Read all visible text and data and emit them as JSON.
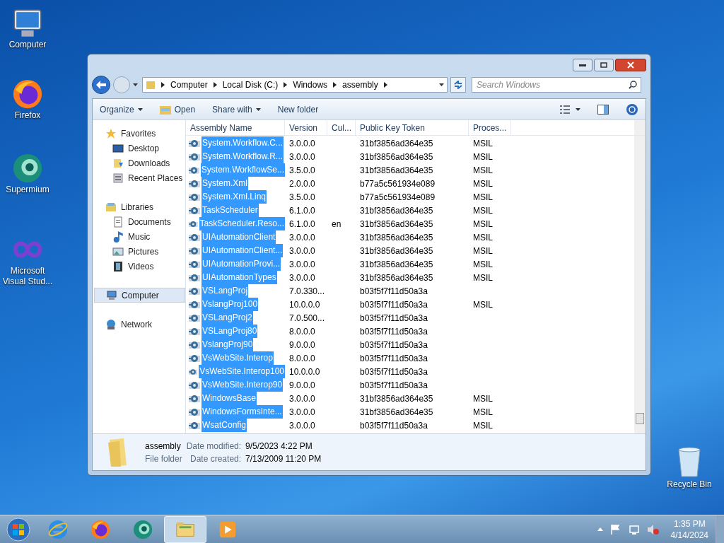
{
  "desktop_icons": [
    {
      "label": "Computer",
      "kind": "computer"
    },
    {
      "label": "Firefox",
      "kind": "firefox"
    },
    {
      "label": "Supermium",
      "kind": "supermium"
    },
    {
      "label": "Microsoft Visual Stud...",
      "kind": "vs"
    }
  ],
  "recycle_bin": {
    "label": "Recycle Bin"
  },
  "window": {
    "breadcrumbs": [
      "Computer",
      "Local Disk (C:)",
      "Windows",
      "assembly"
    ],
    "search": {
      "placeholder": "Search Windows"
    },
    "toolbar": [
      {
        "label": "Organize",
        "kind": "menu"
      },
      {
        "label": "Open",
        "kind": "open"
      },
      {
        "label": "Share with",
        "kind": "menu"
      },
      {
        "label": "New folder",
        "kind": "plain"
      }
    ],
    "sidebar": [
      {
        "label": "Favorites",
        "kind": "star",
        "selected": false,
        "children": [
          {
            "label": "Desktop",
            "kind": "desktop",
            "selected": false
          },
          {
            "label": "Downloads",
            "kind": "downloads",
            "selected": false
          },
          {
            "label": "Recent Places",
            "kind": "recent",
            "selected": false
          }
        ]
      },
      {
        "label": "Libraries",
        "kind": "library",
        "selected": false,
        "children": [
          {
            "label": "Documents",
            "kind": "documents",
            "selected": false
          },
          {
            "label": "Music",
            "kind": "music",
            "selected": false
          },
          {
            "label": "Pictures",
            "kind": "pictures",
            "selected": false
          },
          {
            "label": "Videos",
            "kind": "videos",
            "selected": false
          }
        ]
      },
      {
        "label": "Computer",
        "kind": "computer",
        "selected": true
      },
      {
        "label": "Network",
        "kind": "network",
        "selected": false
      }
    ],
    "table": {
      "columns": [
        "Assembly Name",
        "Version",
        "Cul...",
        "Public Key Token",
        "Proces..."
      ],
      "rows": [
        {
          "name": "System.Workflow.C...",
          "version": "3.0.0.0",
          "culture": "",
          "token": "31bf3856ad364e35",
          "processor": "MSIL",
          "selected": true
        },
        {
          "name": "System.Workflow.R...",
          "version": "3.0.0.0",
          "culture": "",
          "token": "31bf3856ad364e35",
          "processor": "MSIL",
          "selected": true
        },
        {
          "name": "System.WorkflowSe...",
          "version": "3.5.0.0",
          "culture": "",
          "token": "31bf3856ad364e35",
          "processor": "MSIL",
          "selected": true
        },
        {
          "name": "System.Xml",
          "version": "2.0.0.0",
          "culture": "",
          "token": "b77a5c561934e089",
          "processor": "MSIL",
          "selected": true
        },
        {
          "name": "System.Xml.Linq",
          "version": "3.5.0.0",
          "culture": "",
          "token": "b77a5c561934e089",
          "processor": "MSIL",
          "selected": true
        },
        {
          "name": "TaskScheduler",
          "version": "6.1.0.0",
          "culture": "",
          "token": "31bf3856ad364e35",
          "processor": "MSIL",
          "selected": true
        },
        {
          "name": "TaskScheduler.Reso...",
          "version": "6.1.0.0",
          "culture": "en",
          "token": "31bf3856ad364e35",
          "processor": "MSIL",
          "selected": true
        },
        {
          "name": "UIAutomationClient",
          "version": "3.0.0.0",
          "culture": "",
          "token": "31bf3856ad364e35",
          "processor": "MSIL",
          "selected": true
        },
        {
          "name": "UIAutomationClient...",
          "version": "3.0.0.0",
          "culture": "",
          "token": "31bf3856ad364e35",
          "processor": "MSIL",
          "selected": true
        },
        {
          "name": "UIAutomationProvi...",
          "version": "3.0.0.0",
          "culture": "",
          "token": "31bf3856ad364e35",
          "processor": "MSIL",
          "selected": true
        },
        {
          "name": "UIAutomationTypes",
          "version": "3.0.0.0",
          "culture": "",
          "token": "31bf3856ad364e35",
          "processor": "MSIL",
          "selected": true
        },
        {
          "name": "VSLangProj",
          "version": "7.0.330...",
          "culture": "",
          "token": "b03f5f7f11d50a3a",
          "processor": "",
          "selected": true
        },
        {
          "name": "VslangProj100",
          "version": "10.0.0.0",
          "culture": "",
          "token": "b03f5f7f11d50a3a",
          "processor": "MSIL",
          "selected": true
        },
        {
          "name": "VSLangProj2",
          "version": "7.0.500...",
          "culture": "",
          "token": "b03f5f7f11d50a3a",
          "processor": "",
          "selected": true
        },
        {
          "name": "VSLangProj80",
          "version": "8.0.0.0",
          "culture": "",
          "token": "b03f5f7f11d50a3a",
          "processor": "",
          "selected": true
        },
        {
          "name": "VslangProj90",
          "version": "9.0.0.0",
          "culture": "",
          "token": "b03f5f7f11d50a3a",
          "processor": "",
          "selected": true
        },
        {
          "name": "VsWebSite.Interop",
          "version": "8.0.0.0",
          "culture": "",
          "token": "b03f5f7f11d50a3a",
          "processor": "",
          "selected": true
        },
        {
          "name": "VsWebSite.Interop100",
          "version": "10.0.0.0",
          "culture": "",
          "token": "b03f5f7f11d50a3a",
          "processor": "",
          "selected": true
        },
        {
          "name": "VsWebSite.Interop90",
          "version": "9.0.0.0",
          "culture": "",
          "token": "b03f5f7f11d50a3a",
          "processor": "",
          "selected": true
        },
        {
          "name": "WindowsBase",
          "version": "3.0.0.0",
          "culture": "",
          "token": "31bf3856ad364e35",
          "processor": "MSIL",
          "selected": true
        },
        {
          "name": "WindowsFormsInte...",
          "version": "3.0.0.0",
          "culture": "",
          "token": "31bf3856ad364e35",
          "processor": "MSIL",
          "selected": true
        },
        {
          "name": "WsatConfig",
          "version": "3.0.0.0",
          "culture": "",
          "token": "b03f5f7f11d50a3a",
          "processor": "MSIL",
          "selected": true
        }
      ]
    },
    "details": {
      "name": "assembly",
      "type": "File folder",
      "modified_label": "Date modified:",
      "modified": "9/5/2023 4:22 PM",
      "created_label": "Date created:",
      "created": "7/13/2009 11:20 PM"
    }
  },
  "taskbar": {
    "apps": [
      {
        "kind": "ie",
        "selected": false
      },
      {
        "kind": "firefox",
        "selected": false
      },
      {
        "kind": "supermium",
        "selected": false
      },
      {
        "kind": "explorer",
        "selected": true
      },
      {
        "kind": "media",
        "selected": false
      }
    ],
    "time": "1:35 PM",
    "date": "4/14/2024"
  }
}
